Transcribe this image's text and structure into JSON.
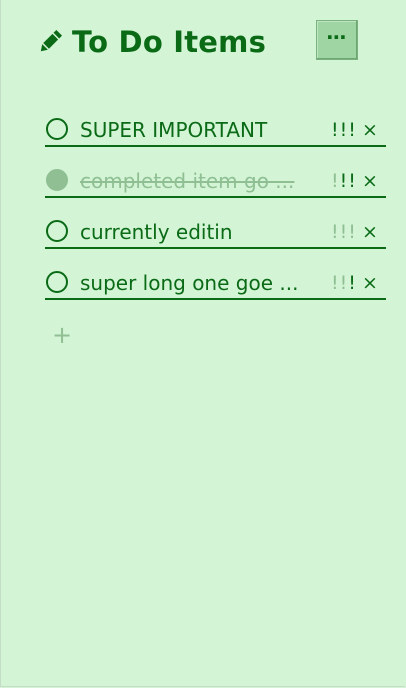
{
  "header": {
    "title": "To Do Items",
    "icon": "pencil-icon",
    "menu_label": "⋯"
  },
  "colors": {
    "background": "#d3f5d6",
    "accent": "#0a6a16",
    "muted": "#8fbf92",
    "button": "#9fd5a3"
  },
  "items": [
    {
      "text": "SUPER IMPORTANT",
      "completed": false,
      "priority": 3,
      "delete_label": "×"
    },
    {
      "text": "completed item go ...",
      "completed": true,
      "priority": 2,
      "delete_label": "×"
    },
    {
      "text": "currently editin",
      "completed": false,
      "priority": 0,
      "delete_label": "×"
    },
    {
      "text": "super long one goe ...",
      "completed": false,
      "priority": 1,
      "delete_label": "×"
    }
  ],
  "add_label": "+"
}
